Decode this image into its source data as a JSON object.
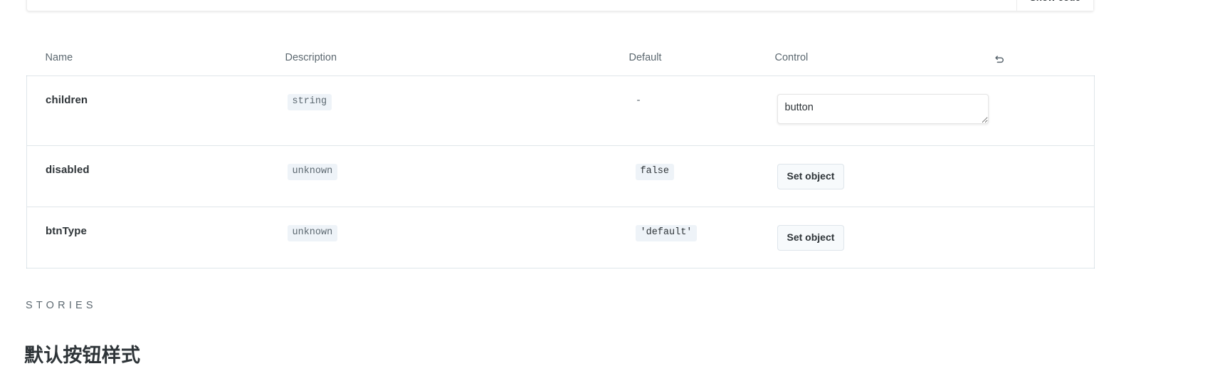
{
  "preview": {
    "show_code_label": "Show code"
  },
  "args_table": {
    "columns": [
      "Name",
      "Description",
      "Default",
      "Control"
    ],
    "reset_icon": "undo-arrow-icon",
    "rows": [
      {
        "name": "children",
        "type": "string",
        "default": "-",
        "default_kind": "dash",
        "control_kind": "textarea",
        "control_value": "button"
      },
      {
        "name": "disabled",
        "type": "unknown",
        "default": "false",
        "default_kind": "code",
        "control_kind": "button",
        "control_value": "Set object"
      },
      {
        "name": "btnType",
        "type": "unknown",
        "default": "'default'",
        "default_kind": "code",
        "control_kind": "button",
        "control_value": "Set object"
      }
    ]
  },
  "stories": {
    "section_label": "STORIES",
    "title": "默认按钮样式"
  },
  "colors": {
    "text_primary": "#2e3438",
    "text_muted": "#5c6870",
    "badge_bg": "#eef3f8",
    "border": "rgba(38,85,115,0.15)",
    "page_bg": "#ffffff"
  }
}
